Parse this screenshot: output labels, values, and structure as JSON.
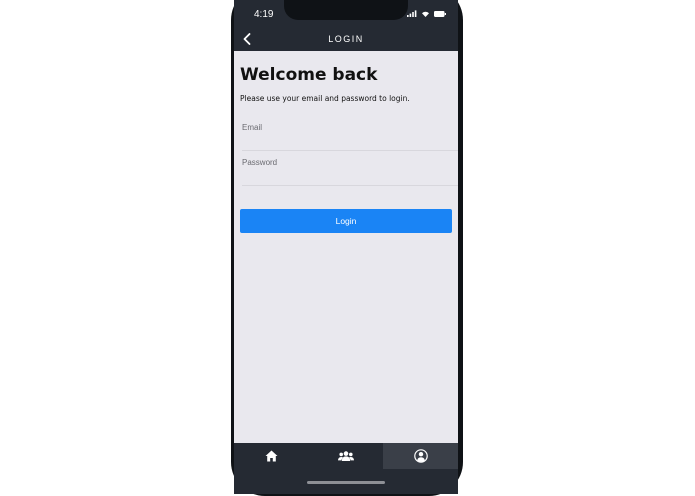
{
  "status_bar": {
    "time": "4:19",
    "icons": [
      "signal-icon",
      "wifi-icon",
      "battery-icon"
    ]
  },
  "nav": {
    "title": "LOGIN",
    "back_icon": "chevron-left-icon"
  },
  "login": {
    "heading": "Welcome back",
    "subtitle": "Please use your email and password to login.",
    "email_placeholder": "Email",
    "email_value": "",
    "password_placeholder": "Password",
    "password_value": "",
    "button_label": "Login"
  },
  "tab_bar": {
    "tabs": [
      {
        "icon": "home-icon",
        "active": false
      },
      {
        "icon": "people-icon",
        "active": false
      },
      {
        "icon": "user-icon",
        "active": true
      }
    ]
  },
  "colors": {
    "header_bg": "#252a33",
    "screen_bg": "#e9e8ee",
    "accent": "#1a84f5",
    "active_tab_bg": "#3a3f48"
  }
}
